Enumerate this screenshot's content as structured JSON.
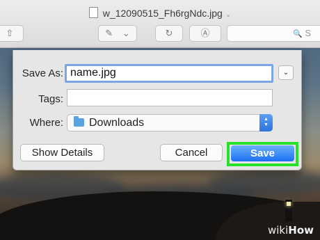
{
  "window": {
    "title": "w_12090515_Fh6rgNdc.jpg",
    "title_chevron": "⌄"
  },
  "toolbar": {
    "share_icon": "⇧",
    "annotate_icon": "✎",
    "annotate_chevron": "⌄",
    "rotate_icon": "↻",
    "markup_icon": "Ⓐ",
    "search_icon": "🔍",
    "search_placeholder": "S"
  },
  "dialog": {
    "save_as_label": "Save As:",
    "save_as_value": "name.jpg",
    "expand_icon": "⌄",
    "tags_label": "Tags:",
    "tags_value": "",
    "where_label": "Where:",
    "where_value": "Downloads",
    "stepper_up": "▲",
    "stepper_down": "▼",
    "show_details_label": "Show Details",
    "cancel_label": "Cancel",
    "save_label": "Save"
  },
  "watermark": {
    "prefix": "wiki",
    "suffix": "How"
  },
  "colors": {
    "highlight": "#27e02a",
    "accent": "#1c6ff0",
    "focus_ring": "#7aa7e4"
  }
}
